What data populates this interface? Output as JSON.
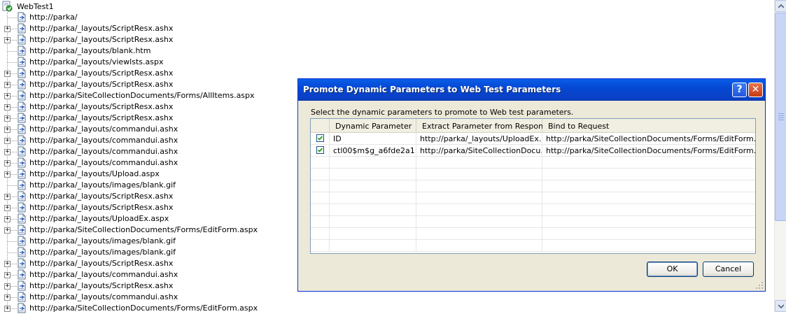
{
  "tree": {
    "root": "WebTest1",
    "items": [
      {
        "url": "http://parka/",
        "expandable": false
      },
      {
        "url": "http://parka/_layouts/ScriptResx.ashx",
        "expandable": true
      },
      {
        "url": "http://parka/_layouts/ScriptResx.ashx",
        "expandable": true
      },
      {
        "url": "http://parka/_layouts/blank.htm",
        "expandable": false
      },
      {
        "url": "http://parka/_layouts/viewlsts.aspx",
        "expandable": false
      },
      {
        "url": "http://parka/_layouts/ScriptResx.ashx",
        "expandable": true
      },
      {
        "url": "http://parka/_layouts/ScriptResx.ashx",
        "expandable": true
      },
      {
        "url": "http://parka/SiteCollectionDocuments/Forms/AllItems.aspx",
        "expandable": true
      },
      {
        "url": "http://parka/_layouts/ScriptResx.ashx",
        "expandable": true
      },
      {
        "url": "http://parka/_layouts/ScriptResx.ashx",
        "expandable": true
      },
      {
        "url": "http://parka/_layouts/commandui.ashx",
        "expandable": true
      },
      {
        "url": "http://parka/_layouts/commandui.ashx",
        "expandable": true
      },
      {
        "url": "http://parka/_layouts/commandui.ashx",
        "expandable": true
      },
      {
        "url": "http://parka/_layouts/commandui.ashx",
        "expandable": true
      },
      {
        "url": "http://parka/_layouts/Upload.aspx",
        "expandable": true
      },
      {
        "url": "http://parka/_layouts/images/blank.gif",
        "expandable": false
      },
      {
        "url": "http://parka/_layouts/ScriptResx.ashx",
        "expandable": true
      },
      {
        "url": "http://parka/_layouts/ScriptResx.ashx",
        "expandable": true
      },
      {
        "url": "http://parka/_layouts/UploadEx.aspx",
        "expandable": true
      },
      {
        "url": "http://parka/SiteCollectionDocuments/Forms/EditForm.aspx",
        "expandable": true
      },
      {
        "url": "http://parka/_layouts/images/blank.gif",
        "expandable": false
      },
      {
        "url": "http://parka/_layouts/images/blank.gif",
        "expandable": false
      },
      {
        "url": "http://parka/_layouts/ScriptResx.ashx",
        "expandable": true
      },
      {
        "url": "http://parka/_layouts/commandui.ashx",
        "expandable": true
      },
      {
        "url": "http://parka/_layouts/ScriptResx.ashx",
        "expandable": true
      },
      {
        "url": "http://parka/_layouts/commandui.ashx",
        "expandable": true
      },
      {
        "url": "http://parka/SiteCollectionDocuments/Forms/EditForm.aspx",
        "expandable": true
      }
    ]
  },
  "dialog": {
    "title": "Promote Dynamic Parameters to Web Test Parameters",
    "help_glyph": "?",
    "close_glyph": "✕",
    "instruction": "Select the dynamic parameters to promote to Web test parameters.",
    "columns": [
      "Dynamic Parameter",
      "Extract Parameter from Response",
      "Bind to Request"
    ],
    "rows": [
      {
        "checked": true,
        "dynamic_parameter": "ID",
        "extract_from": "http://parka/_layouts/UploadEx...",
        "bind_to": "http://parka/SiteCollectionDocuments/Forms/EditForm.aspx"
      },
      {
        "checked": true,
        "dynamic_parameter": "ctl00$m$g_a6fde2a1...",
        "extract_from": "http://parka/SiteCollectionDocu...",
        "bind_to": "http://parka/SiteCollectionDocuments/Forms/EditForm.aspx"
      }
    ],
    "ok_label": "OK",
    "cancel_label": "Cancel"
  },
  "colors": {
    "titlebar": "#0548d4",
    "dialog_face": "#ece9d8",
    "check": "#21a121"
  }
}
